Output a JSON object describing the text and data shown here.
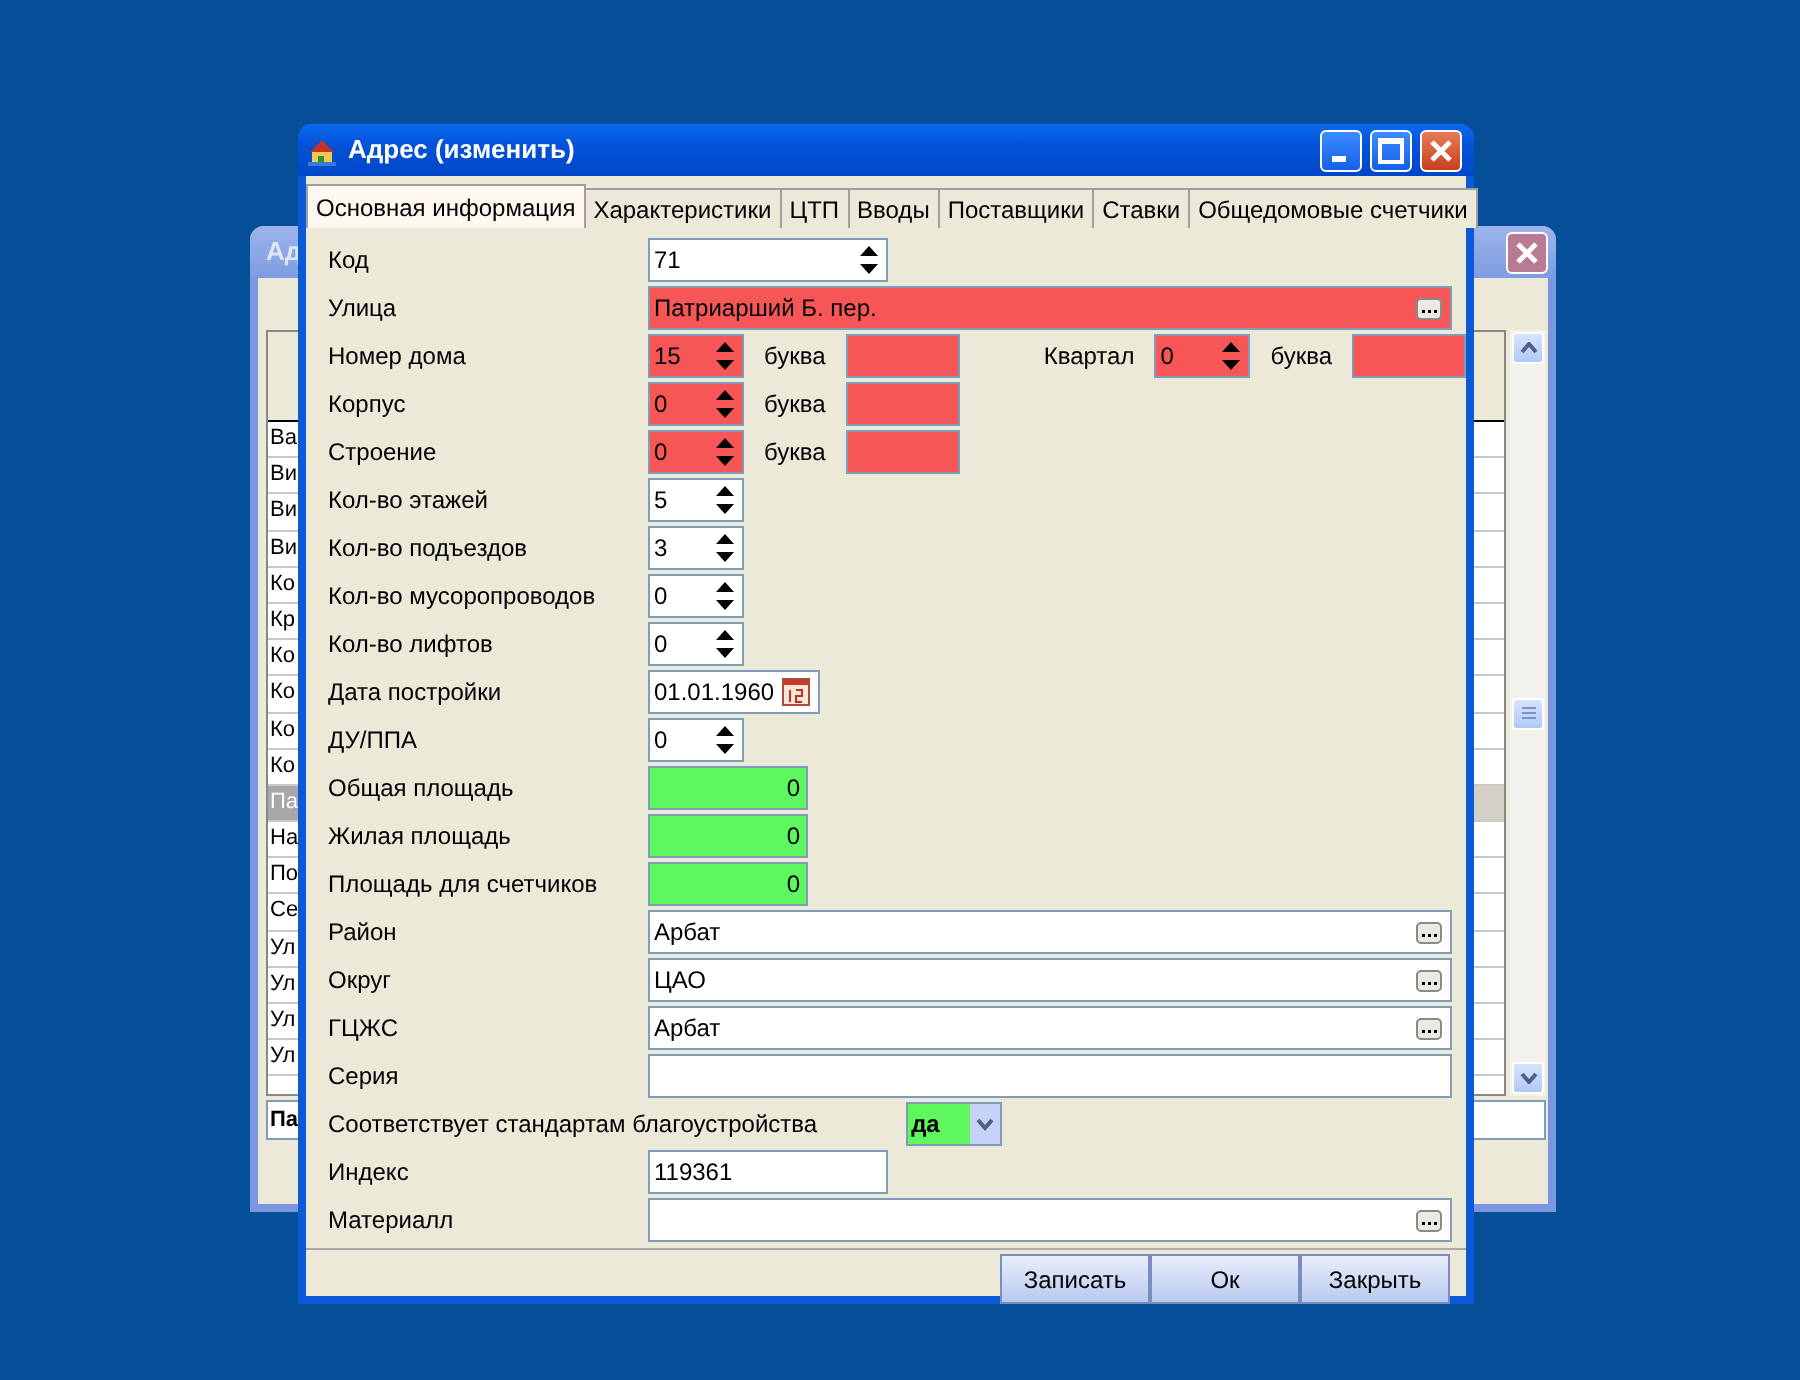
{
  "background_window": {
    "title": "Ад",
    "rows": [
      {
        "text": "Ва",
        "selected": false
      },
      {
        "text": "Ви",
        "selected": false
      },
      {
        "text": "Ви",
        "selected": false
      },
      {
        "text": "Ви",
        "selected": false
      },
      {
        "text": "Ко",
        "selected": false
      },
      {
        "text": "Кр",
        "selected": false
      },
      {
        "text": "Ко",
        "selected": false
      },
      {
        "text": "Ко",
        "selected": false
      },
      {
        "text": "Ко",
        "selected": false
      },
      {
        "text": "Ко",
        "selected": false
      },
      {
        "text": "Па",
        "selected": true
      },
      {
        "text": "На",
        "selected": false
      },
      {
        "text": "По",
        "selected": false
      },
      {
        "text": "Се",
        "selected": false
      },
      {
        "text": "Ул",
        "selected": false
      },
      {
        "text": "Ул",
        "selected": false
      },
      {
        "text": "Ул",
        "selected": false
      },
      {
        "text": "Ул",
        "selected": false
      }
    ],
    "footer": "Па"
  },
  "window": {
    "title": "Адрес (изменить)"
  },
  "tabs": [
    {
      "label": "Основная информация",
      "selected": true
    },
    {
      "label": "Характеристики",
      "selected": false
    },
    {
      "label": "ЦТП",
      "selected": false
    },
    {
      "label": "Вводы",
      "selected": false
    },
    {
      "label": "Поставщики",
      "selected": false
    },
    {
      "label": "Ставки",
      "selected": false
    },
    {
      "label": "Общедомовые счетчики",
      "selected": false
    }
  ],
  "fields": [
    {
      "label": "Код",
      "kind": "code",
      "value": "71"
    },
    {
      "label": "Улица",
      "kind": "lookup",
      "value": "Патриарший Б. пер.",
      "color": "#f75656"
    },
    {
      "label": "Номер дома",
      "kind": "spin",
      "value": "15",
      "color": "#f75656",
      "extras": [
        {
          "kind": "caption",
          "text": "буква"
        },
        {
          "kind": "box",
          "color": "#f75656"
        },
        {
          "kind": "caption",
          "text": "Квартал"
        },
        {
          "kind": "spin",
          "value": "0",
          "color": "#f75656"
        },
        {
          "kind": "caption",
          "text": "буква"
        },
        {
          "kind": "box",
          "color": "#f75656"
        }
      ]
    },
    {
      "label": "Корпус",
      "kind": "spin",
      "value": "0",
      "color": "#f75656",
      "extras": [
        {
          "kind": "caption",
          "text": "буква"
        },
        {
          "kind": "box",
          "color": "#f75656"
        }
      ]
    },
    {
      "label": "Строение",
      "kind": "spin",
      "value": "0",
      "color": "#f75656",
      "extras": [
        {
          "kind": "caption",
          "text": "буква"
        },
        {
          "kind": "box",
          "color": "#f75656"
        }
      ]
    },
    {
      "label": "Кол-во этажей",
      "kind": "spin",
      "value": "5"
    },
    {
      "label": "Кол-во подъездов",
      "kind": "spin",
      "value": "3"
    },
    {
      "label": "Кол-во мусоропроводов",
      "kind": "spin",
      "value": "0"
    },
    {
      "label": "Кол-во лифтов",
      "kind": "spin",
      "value": "0"
    },
    {
      "label": "Дата постройки",
      "kind": "date",
      "value": "01.01.1960"
    },
    {
      "label": "ДУ/ППА",
      "kind": "spin",
      "value": "0"
    },
    {
      "label": "Общая площадь",
      "kind": "area",
      "value": "0",
      "color": "#5ef75e"
    },
    {
      "label": "Жилая площадь",
      "kind": "area",
      "value": "0",
      "color": "#5ef75e"
    },
    {
      "label": "Площадь для счетчиков",
      "kind": "area",
      "value": "0",
      "color": "#5ef75e"
    },
    {
      "label": "Район",
      "kind": "lookup",
      "value": "Арбат"
    },
    {
      "label": "Округ",
      "kind": "lookup",
      "value": "ЦАО"
    },
    {
      "label": "ГЦЖС",
      "kind": "lookup",
      "value": "Арбат"
    },
    {
      "label": "Серия",
      "kind": "text"
    },
    {
      "label": "Соответствует стандартам благоустройства",
      "kind": "combo",
      "value": "да",
      "color": "#5ef75e"
    },
    {
      "label": "Индекс",
      "kind": "short",
      "value": "119361"
    },
    {
      "label": "Материалл",
      "kind": "lookup"
    }
  ],
  "buttons": [
    "Записать",
    "Ок",
    "Закрыть"
  ]
}
